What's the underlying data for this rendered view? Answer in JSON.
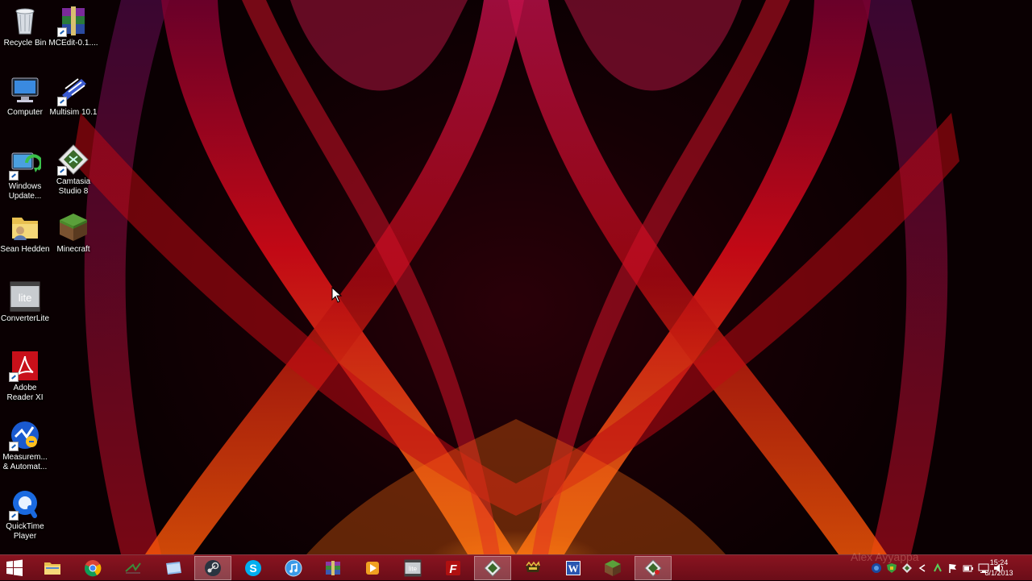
{
  "desktop": {
    "icons": [
      {
        "label": "Recycle Bin",
        "icon": "recycle-bin-icon"
      },
      {
        "label": "MCEdit-0.1....",
        "icon": "winrar-archive-icon"
      },
      {
        "label": "Computer",
        "icon": "computer-icon"
      },
      {
        "label": "Multisim 10.1",
        "icon": "multisim-icon"
      },
      {
        "label": "Windows Update...",
        "icon": "windows-update-icon"
      },
      {
        "label": "Camtasia Studio 8",
        "icon": "camtasia-icon"
      },
      {
        "label": "Sean Hedden",
        "icon": "user-folder-icon"
      },
      {
        "label": "Minecraft",
        "icon": "minecraft-icon"
      },
      {
        "label": "ConverterLite",
        "icon": "converterlite-icon"
      },
      {
        "label": "Adobe Reader XI",
        "icon": "adobe-reader-icon"
      },
      {
        "label": "Measurem... & Automat...",
        "icon": "measurement-automation-icon"
      },
      {
        "label": "QuickTime Player",
        "icon": "quicktime-icon"
      }
    ]
  },
  "taskbar": {
    "items": [
      {
        "name": "start-button",
        "icon": "windows-logo-icon"
      },
      {
        "name": "file-explorer",
        "icon": "folder-icon"
      },
      {
        "name": "google-chrome",
        "icon": "chrome-icon"
      },
      {
        "name": "multisim",
        "icon": "multisim-icon"
      },
      {
        "name": "file-manager",
        "icon": "manila-folder-icon"
      },
      {
        "name": "steam",
        "icon": "steam-icon"
      },
      {
        "name": "skype",
        "icon": "skype-icon"
      },
      {
        "name": "itunes",
        "icon": "itunes-icon"
      },
      {
        "name": "winrar",
        "icon": "winrar-icon"
      },
      {
        "name": "media-player",
        "icon": "play-icon"
      },
      {
        "name": "converterlite",
        "icon": "lite-icon"
      },
      {
        "name": "filezilla",
        "icon": "filezilla-icon"
      },
      {
        "name": "camtasia-recorder",
        "icon": "camtasia-icon"
      },
      {
        "name": "game-app",
        "icon": "game-icon"
      },
      {
        "name": "microsoft-word",
        "icon": "word-icon"
      },
      {
        "name": "minecraft",
        "icon": "minecraft-icon"
      },
      {
        "name": "camtasia-studio",
        "icon": "camtasia-icon"
      }
    ],
    "clock": {
      "time": "15:24",
      "date": "8/1/2013"
    },
    "watermark": "Alex Ayyappa"
  },
  "colors": {
    "taskbar": "#7a1020",
    "ribbon_red": "#e01010",
    "ribbon_orange": "#ff8a10",
    "background_dark": "#140004"
  }
}
